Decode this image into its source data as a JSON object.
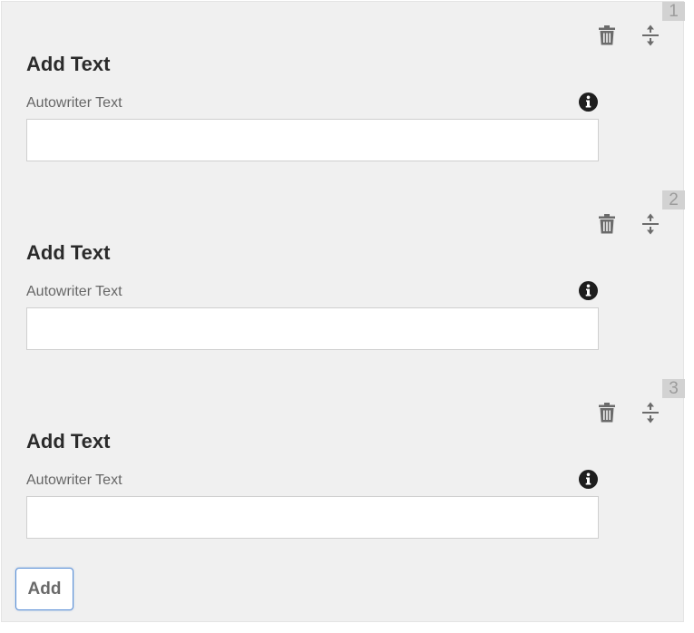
{
  "blocks": [
    {
      "number": "1",
      "title": "Add Text",
      "field_label": "Autowriter Text",
      "input_value": "",
      "icons": [
        "trash-icon",
        "move-icon",
        "info-icon"
      ]
    },
    {
      "number": "2",
      "title": "Add Text",
      "field_label": "Autowriter Text",
      "input_value": "",
      "icons": [
        "trash-icon",
        "move-icon",
        "info-icon"
      ]
    },
    {
      "number": "3",
      "title": "Add Text",
      "field_label": "Autowriter Text",
      "input_value": "",
      "icons": [
        "trash-icon",
        "move-icon",
        "info-icon"
      ]
    }
  ],
  "add_button": {
    "label": "Add"
  },
  "colors": {
    "panel_background": "#f0f0f0",
    "icon": "#6b6b6b",
    "info_icon": "#1e1e1e",
    "add_button_border": "#5a8fd6"
  }
}
